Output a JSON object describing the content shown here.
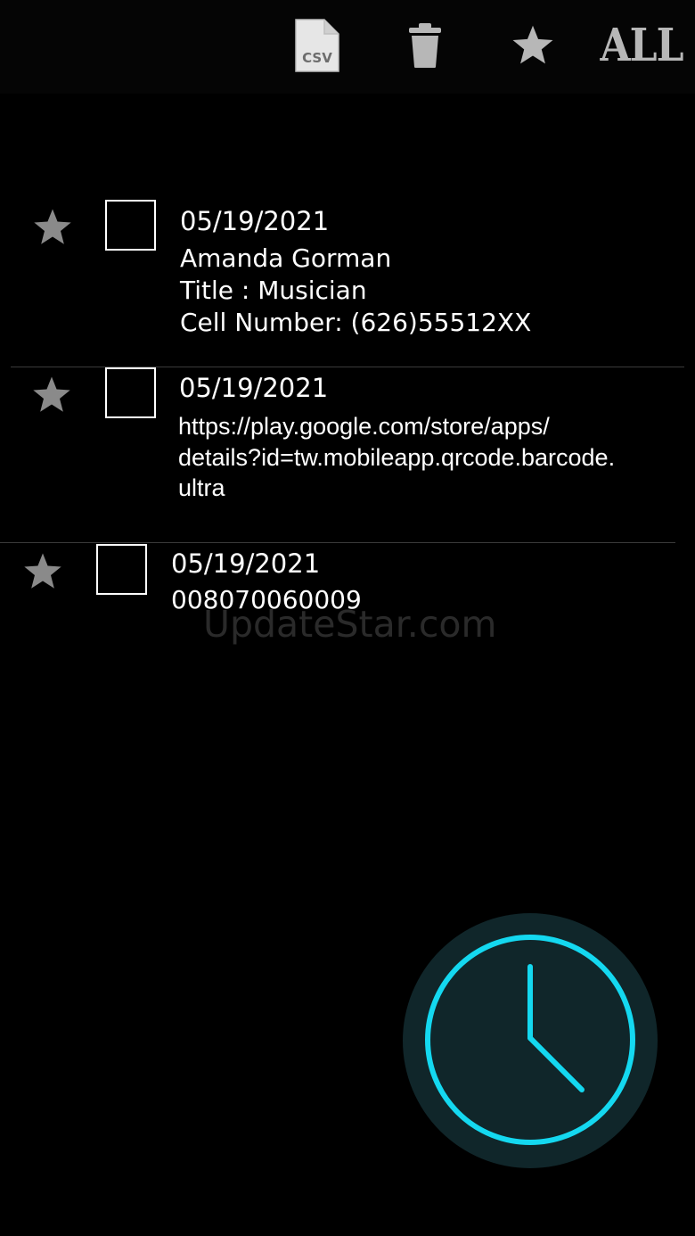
{
  "toolbar": {
    "csv_label": "CSV",
    "all_label": "ALL",
    "icons": [
      "csv-file-icon",
      "trash-icon",
      "star-icon"
    ]
  },
  "records": [
    {
      "date": "05/19/2021",
      "lines": [
        "Amanda Gorman",
        "Title : Musician",
        "Cell Number: (626)55512XX"
      ]
    },
    {
      "date": "05/19/2021",
      "url_lines": [
        "https://play.google.com/store/apps/",
        "details?id=tw.mobileapp.qrcode.barcode.",
        "ultra"
      ]
    },
    {
      "date": "05/19/2021",
      "lines": [
        "008070060009"
      ]
    }
  ],
  "watermark": "UpdateStar.com",
  "colors": {
    "background": "#000000",
    "icon_gray": "#b7b7b7",
    "star_gray": "#8a8a8a",
    "fab_ring": "#14d8f0",
    "fab_bg": "#10262a"
  },
  "fab_icon": "clock-icon"
}
